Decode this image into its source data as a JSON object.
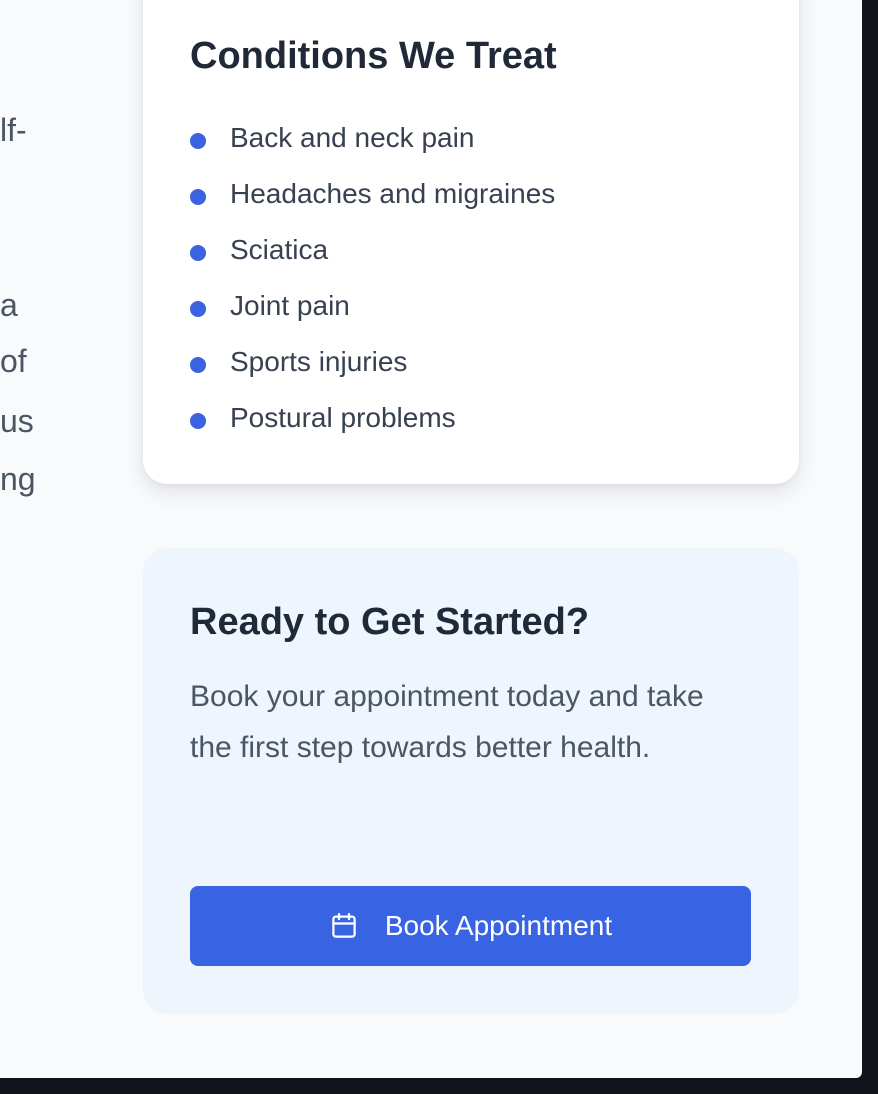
{
  "left_column": {
    "lines": [
      "lf-",
      "a",
      "of",
      "us",
      "ng"
    ]
  },
  "conditions": {
    "title": "Conditions We Treat",
    "items": [
      "Back and neck pain",
      "Headaches and migraines",
      "Sciatica",
      "Joint pain",
      "Sports injuries",
      "Postural problems"
    ]
  },
  "cta": {
    "title": "Ready to Get Started?",
    "description": "Book your appointment today and take the first step towards better health.",
    "button_label": "Book Appointment",
    "button_icon": "calendar-icon"
  },
  "colors": {
    "accent": "#3863e3",
    "bullet": "#3b63e1",
    "heading": "#1f2937",
    "body_text": "#4b5563",
    "cta_background": "#eef5fd",
    "page_background": "#f8fafc"
  }
}
